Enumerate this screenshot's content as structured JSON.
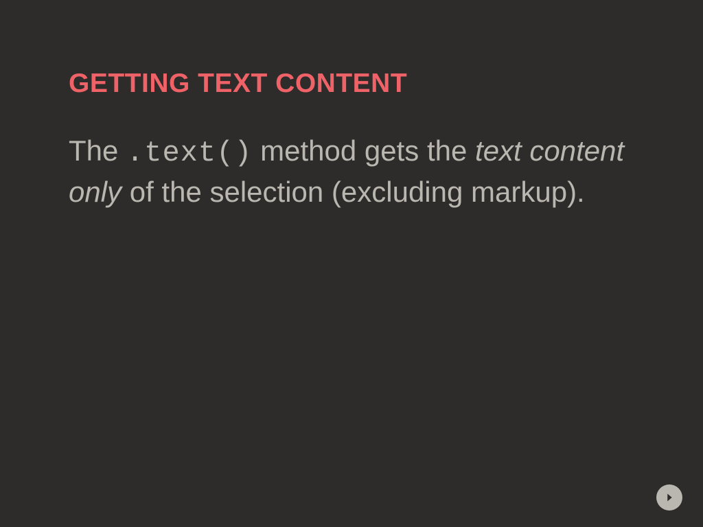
{
  "slide": {
    "heading": "GETTING TEXT CONTENT",
    "body": {
      "prefix": "The ",
      "code": ".text()",
      "mid": " method gets the ",
      "italic": "text content only",
      "suffix": " of the selection (excluding markup)."
    }
  },
  "nav": {
    "next_icon": "arrow-right"
  }
}
